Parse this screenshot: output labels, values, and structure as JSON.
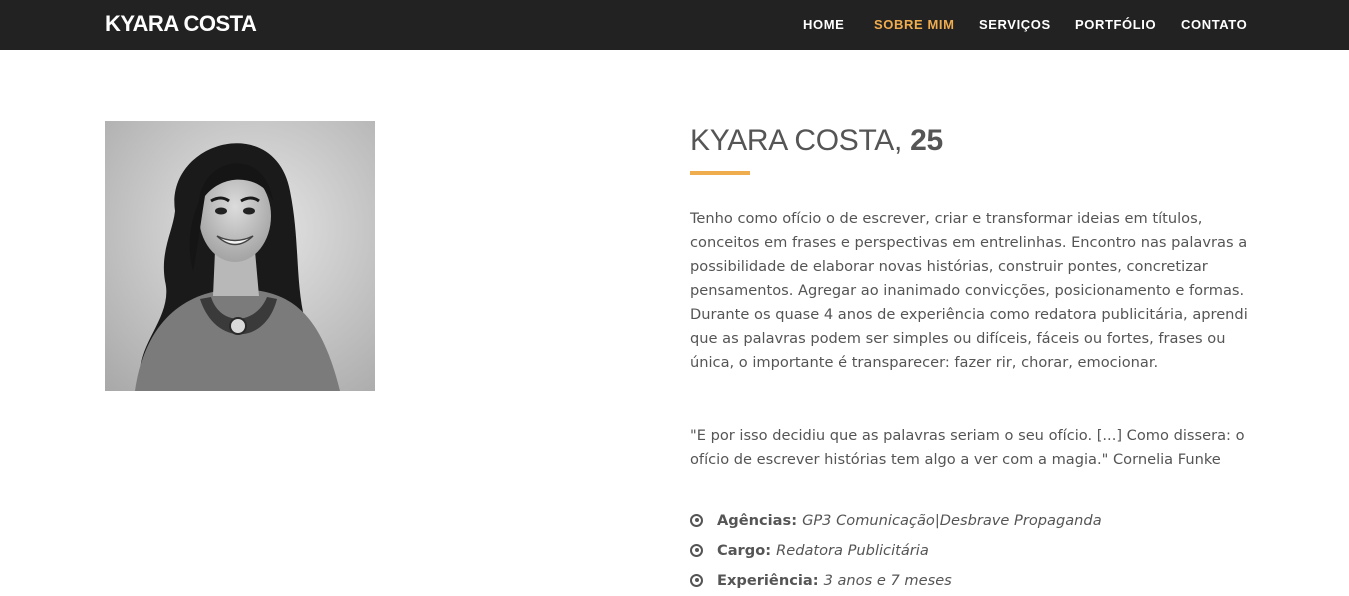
{
  "navbar": {
    "brand": "KYARA COSTA",
    "items": [
      {
        "label": "HOME",
        "active": false
      },
      {
        "label": "SOBRE MIM",
        "active": true
      },
      {
        "label": "SERVIÇOS",
        "active": false
      },
      {
        "label": "PORTFÓLIO",
        "active": false
      },
      {
        "label": "CONTATO",
        "active": false
      }
    ]
  },
  "profile": {
    "name": "KYARA COSTA,",
    "age": "25",
    "bio": "Tenho como ofício o de escrever, criar e transformar ideias em títulos, conceitos em frases e perspectivas em entrelinhas. Encontro nas palavras a possibilidade de elaborar novas histórias, construir pontes, concretizar pensamentos. Agregar ao inanimado convicções, posicionamento e formas. Durante os quase 4 anos de experiência como redatora publicitária, aprendi que as palavras podem ser simples ou difíceis, fáceis ou fortes, frases ou única, o importante é transparecer: fazer rir, chorar, emocionar.",
    "quote": "\"E por isso decidiu que as palavras seriam o seu ofício. [...] Como dissera: o ofício de escrever histórias tem algo a ver com a magia.\" Cornelia Funke",
    "details": [
      {
        "label": "Agências:",
        "value": "GP3 Comunicação|Desbrave Propaganda"
      },
      {
        "label": "Cargo:",
        "value": "Redatora Publicitária"
      },
      {
        "label": "Experiência:",
        "value": "3 anos e 7 meses"
      }
    ]
  },
  "colors": {
    "navbar_bg": "#222222",
    "accent": "#f0ad4e",
    "text": "#555555"
  }
}
